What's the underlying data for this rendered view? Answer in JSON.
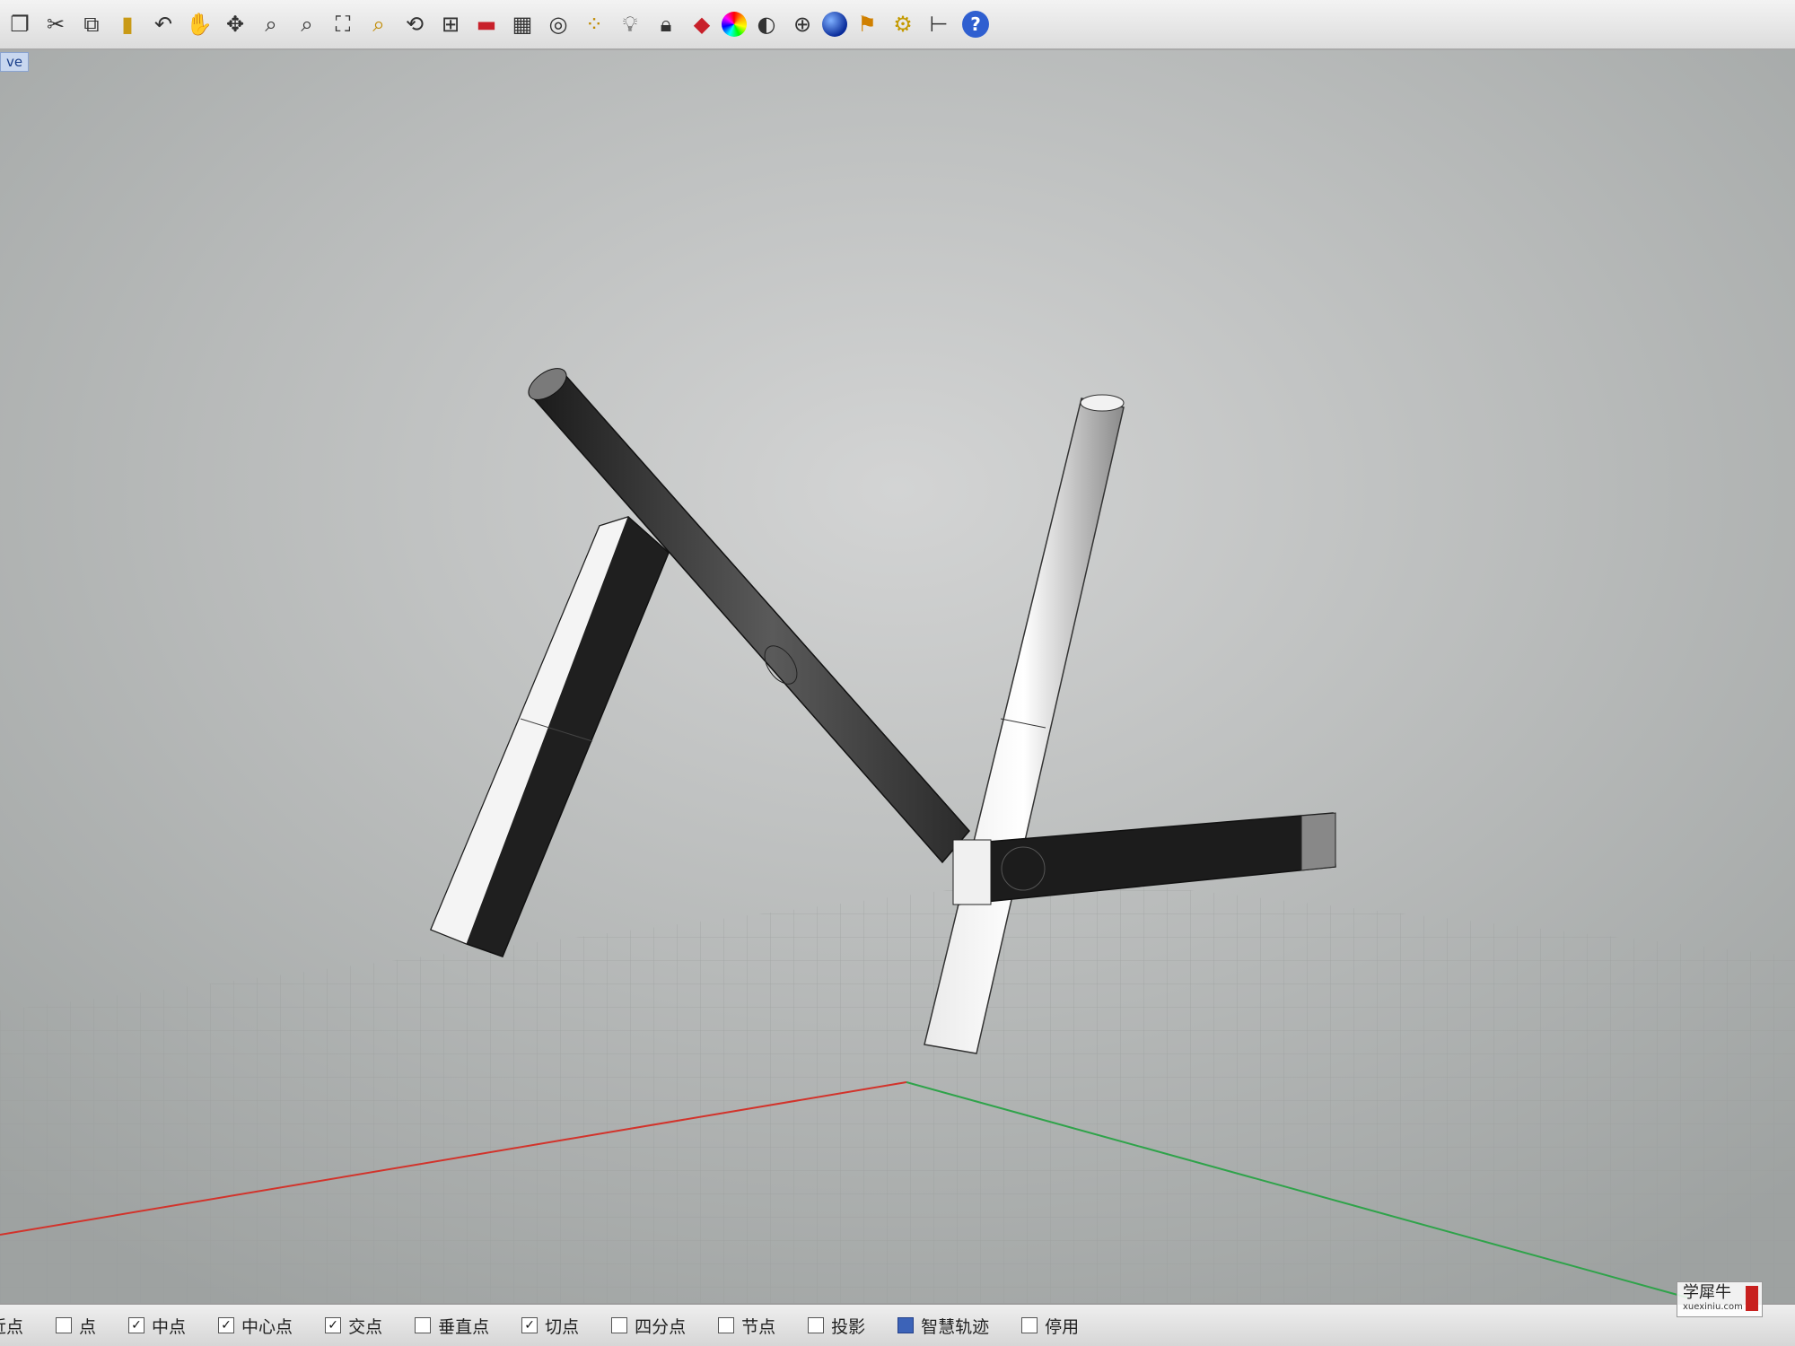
{
  "toolbar": {
    "icons": [
      "new-icon",
      "cut-icon",
      "copy-icon",
      "paste-icon",
      "undo-icon",
      "pan-hand-icon",
      "move-icon",
      "zoom-in-icon",
      "zoom-window-icon",
      "zoom-extents-icon",
      "zoom-selected-icon",
      "rotate-view-icon",
      "four-viewports-icon",
      "car-icon",
      "grid-plane-icon",
      "target-icon",
      "points-icon",
      "lightbulb-icon",
      "lock-icon",
      "layer-book-icon",
      "color-wheel-icon",
      "shade-sphere-icon",
      "wire-sphere-icon",
      "render-sphere-icon",
      "flag-icon",
      "gear-icon",
      "dimension-icon",
      "help-icon"
    ],
    "help_glyph": "?"
  },
  "viewport": {
    "label": "ve",
    "axis_colors": {
      "x": "#d2332b",
      "y": "#2fa34a"
    },
    "background": "#bfc0c0"
  },
  "status": {
    "snaps": [
      {
        "label": "近点",
        "checked": false
      },
      {
        "label": "点",
        "checked": false
      },
      {
        "label": "中点",
        "checked": true
      },
      {
        "label": "中心点",
        "checked": true
      },
      {
        "label": "交点",
        "checked": true
      },
      {
        "label": "垂直点",
        "checked": false
      },
      {
        "label": "切点",
        "checked": true
      },
      {
        "label": "四分点",
        "checked": false
      },
      {
        "label": "节点",
        "checked": false
      },
      {
        "label": "投影",
        "checked": false
      },
      {
        "label": "智慧轨迹",
        "checked": true,
        "selected": true
      },
      {
        "label": "停用",
        "checked": false
      }
    ]
  },
  "watermark": {
    "text": "学犀牛",
    "url": "xuexiniu.com"
  }
}
